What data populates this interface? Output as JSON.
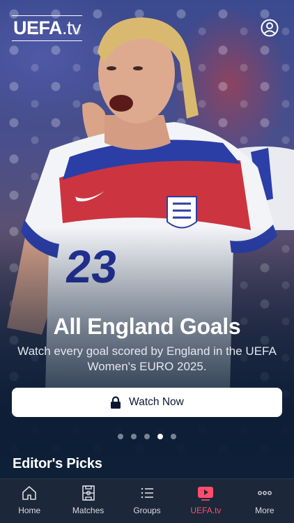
{
  "header": {
    "logo_bold": "UEFA",
    "logo_light": ".tv",
    "account_icon": "person-circle-icon"
  },
  "hero": {
    "title": "All England Goals",
    "subtitle": "Watch every goal scored by England in the UEFA Women's EURO 2025.",
    "button_label": "Watch Now",
    "button_icon": "lock-icon",
    "carousel_count": 5,
    "carousel_active": 4,
    "shirt_number": "23"
  },
  "section": {
    "title": "Editor's Picks"
  },
  "tabbar": {
    "items": [
      {
        "label": "Home",
        "icon": "home-icon",
        "active": false
      },
      {
        "label": "Matches",
        "icon": "pitch-icon",
        "active": false
      },
      {
        "label": "Groups",
        "icon": "list-icon",
        "active": false
      },
      {
        "label": "UEFA.tv",
        "icon": "play-icon",
        "active": true
      },
      {
        "label": "More",
        "icon": "more-dots-icon",
        "active": false
      }
    ],
    "active_color": "#ff4d6a"
  }
}
